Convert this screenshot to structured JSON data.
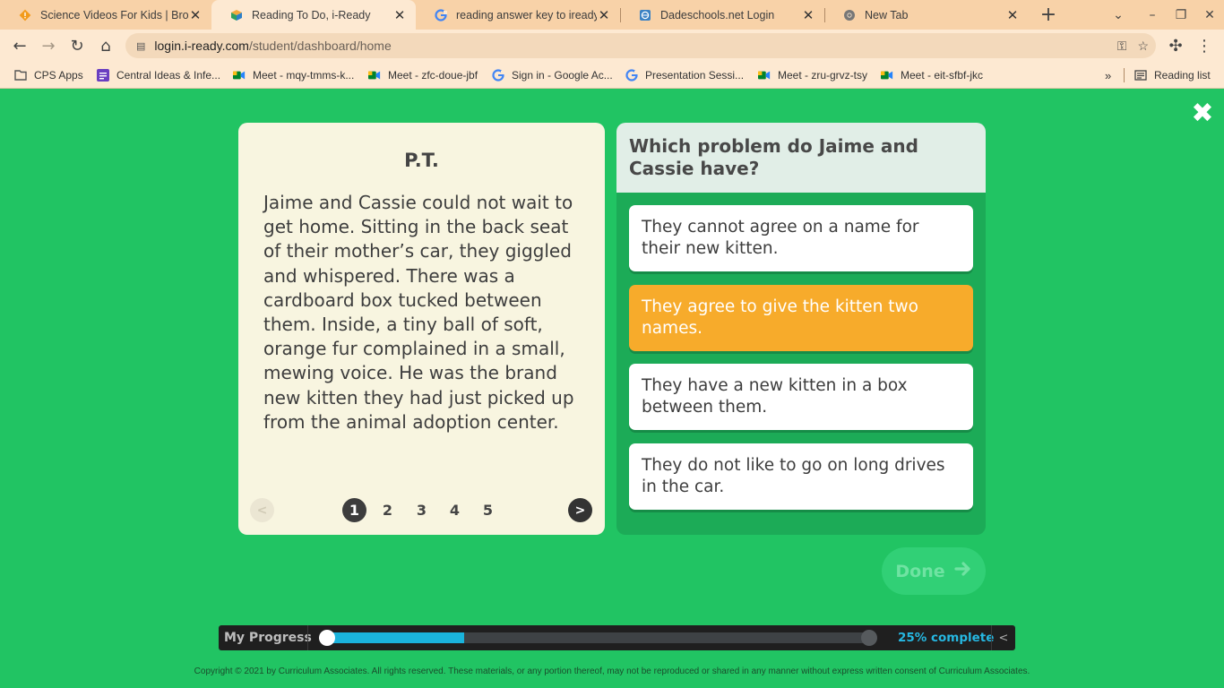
{
  "colors": {
    "app_background": "#21c463",
    "selected_answer": "#f7ab2b",
    "progress_fill": "#1ab3dc",
    "tabbar": "#f8d2a8",
    "toolbar": "#fde9d2"
  },
  "browser": {
    "tabs": [
      {
        "title": "Science Videos For Kids | Brow",
        "icon": "warning-diamond-icon",
        "active": false
      },
      {
        "title": "Reading To Do, i-Ready",
        "icon": "iready-cube-icon",
        "active": true
      },
      {
        "title": "reading answer key to iready -",
        "icon": "google-g-icon",
        "active": false
      },
      {
        "title": "Dadeschools.net Login",
        "icon": "globe-icon",
        "active": false
      },
      {
        "title": "New Tab",
        "icon": "chrome-icon",
        "active": false
      }
    ],
    "url_host": "login.i-ready.com",
    "url_path": "/student/dashboard/home",
    "bookmarks": [
      {
        "label": "CPS Apps",
        "icon": "folder-icon"
      },
      {
        "label": "Central Ideas & Infe...",
        "icon": "list-icon"
      },
      {
        "label": "Meet - mqy-tmms-k...",
        "icon": "meet-icon"
      },
      {
        "label": "Meet - zfc-doue-jbf",
        "icon": "meet-icon"
      },
      {
        "label": "Sign in - Google Ac...",
        "icon": "google-g-icon"
      },
      {
        "label": "Presentation Sessi...",
        "icon": "google-g-icon"
      },
      {
        "label": "Meet - zru-grvz-tsy",
        "icon": "meet-icon"
      },
      {
        "label": "Meet - eit-sfbf-jkc",
        "icon": "meet-icon"
      }
    ],
    "reading_list": "Reading list"
  },
  "passage": {
    "title": "P.T.",
    "text": "Jaime and Cassie could not wait to get home. Sitting in the back seat of their mother’s car, they giggled and whispered. There was a cardboard box tucked between them. Inside, a tiny ball of soft, orange fur complained in a small, mewing voice. He was the brand new kitten they had just picked up from the animal adoption center.",
    "pages": [
      "1",
      "2",
      "3",
      "4",
      "5"
    ],
    "current_page": "1",
    "prev_label": "<",
    "next_label": ">"
  },
  "question": {
    "prompt": "Which problem do Jaime and Cassie have?",
    "answers": [
      {
        "text": "They cannot agree on a name for their new kitten.",
        "selected": false
      },
      {
        "text": "They agree to give the kitten two names.",
        "selected": true
      },
      {
        "text": "They have a new kitten in a box between them.",
        "selected": false
      },
      {
        "text": "They do not like to go on long drives in the car.",
        "selected": false
      }
    ]
  },
  "done_label": "Done",
  "progress": {
    "label": "My Progress",
    "percent": 25,
    "percent_text": "25% complete",
    "collapse_label": "<"
  },
  "copyright": "Copyright © 2021 by Curriculum Associates. All rights reserved. These materials, or any portion thereof, may not be reproduced or shared in any manner without express written consent of Curriculum Associates."
}
